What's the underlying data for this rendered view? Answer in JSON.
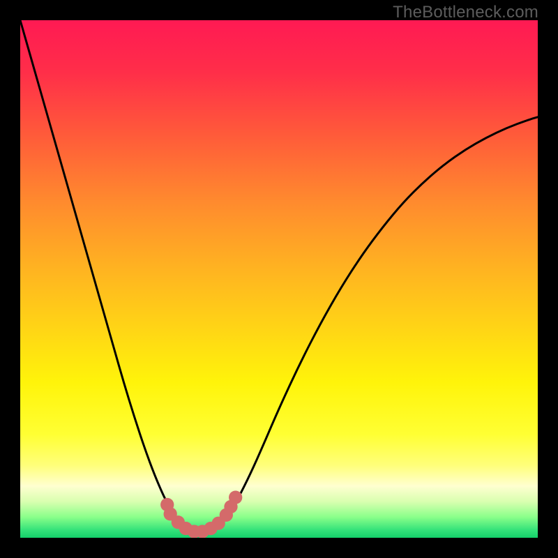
{
  "watermark": "TheBottleneck.com",
  "gradient": {
    "stops": [
      {
        "offset": 0.0,
        "color": "#ff1a53"
      },
      {
        "offset": 0.1,
        "color": "#ff2e49"
      },
      {
        "offset": 0.22,
        "color": "#ff5a3a"
      },
      {
        "offset": 0.35,
        "color": "#ff8a2e"
      },
      {
        "offset": 0.48,
        "color": "#ffb321"
      },
      {
        "offset": 0.6,
        "color": "#ffd615"
      },
      {
        "offset": 0.7,
        "color": "#fff40a"
      },
      {
        "offset": 0.8,
        "color": "#ffff33"
      },
      {
        "offset": 0.86,
        "color": "#ffff7a"
      },
      {
        "offset": 0.9,
        "color": "#ffffd0"
      },
      {
        "offset": 0.93,
        "color": "#d9ffb0"
      },
      {
        "offset": 0.96,
        "color": "#8aff8a"
      },
      {
        "offset": 0.985,
        "color": "#34e27a"
      },
      {
        "offset": 1.0,
        "color": "#14d06a"
      }
    ]
  },
  "chart_data": {
    "type": "line",
    "title": "",
    "xlabel": "",
    "ylabel": "",
    "xlim": [
      0,
      1
    ],
    "ylim": [
      0,
      1
    ],
    "grid": false,
    "legend": false,
    "series": [
      {
        "name": "bottleneck-curve",
        "x": [
          0.0,
          0.02,
          0.04,
          0.06,
          0.08,
          0.1,
          0.12,
          0.14,
          0.16,
          0.18,
          0.2,
          0.22,
          0.24,
          0.26,
          0.28,
          0.295,
          0.31,
          0.32,
          0.33,
          0.338,
          0.35,
          0.365,
          0.38,
          0.4,
          0.42,
          0.445,
          0.47,
          0.5,
          0.54,
          0.58,
          0.62,
          0.66,
          0.7,
          0.74,
          0.78,
          0.82,
          0.86,
          0.9,
          0.94,
          0.98,
          1.0
        ],
        "y": [
          1.0,
          0.93,
          0.86,
          0.79,
          0.72,
          0.65,
          0.58,
          0.51,
          0.44,
          0.37,
          0.3,
          0.235,
          0.174,
          0.12,
          0.074,
          0.048,
          0.026,
          0.016,
          0.01,
          0.008,
          0.008,
          0.01,
          0.018,
          0.04,
          0.074,
          0.124,
          0.18,
          0.25,
          0.336,
          0.414,
          0.484,
          0.546,
          0.6,
          0.648,
          0.688,
          0.722,
          0.75,
          0.773,
          0.792,
          0.807,
          0.813
        ]
      }
    ],
    "markers": {
      "name": "bottom-dots",
      "color": "#d46a6a",
      "radius_frac": 0.013,
      "points": [
        {
          "x": 0.284,
          "y": 0.064
        },
        {
          "x": 0.29,
          "y": 0.046
        },
        {
          "x": 0.305,
          "y": 0.03
        },
        {
          "x": 0.32,
          "y": 0.018
        },
        {
          "x": 0.336,
          "y": 0.012
        },
        {
          "x": 0.352,
          "y": 0.012
        },
        {
          "x": 0.368,
          "y": 0.018
        },
        {
          "x": 0.383,
          "y": 0.028
        },
        {
          "x": 0.398,
          "y": 0.044
        },
        {
          "x": 0.407,
          "y": 0.06
        },
        {
          "x": 0.416,
          "y": 0.078
        }
      ]
    }
  }
}
